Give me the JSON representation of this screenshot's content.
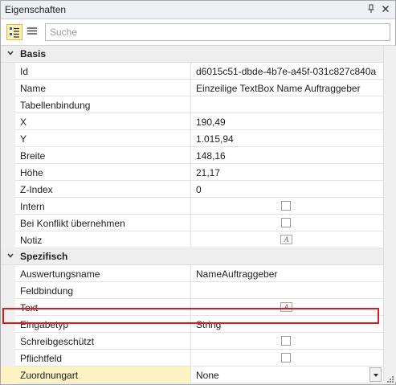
{
  "window": {
    "title": "Eigenschaften",
    "pin_glyph": "⮾",
    "close_glyph": "✕"
  },
  "toolbar": {
    "categorized_icon": "categorized-view-icon",
    "alphabetical_icon": "list-view-icon",
    "search_placeholder": "Suche"
  },
  "categories": {
    "basis": {
      "label": "Basis",
      "rows": [
        {
          "name": "Id",
          "value": "d6015c51-dbde-4b7e-a45f-031c827c840a",
          "editor": "text"
        },
        {
          "name": "Name",
          "value": "Einzeilige TextBox Name Auftraggeber",
          "editor": "text"
        },
        {
          "name": "Tabellenbindung",
          "value": "",
          "editor": "text"
        },
        {
          "name": "X",
          "value": "190,49",
          "editor": "text"
        },
        {
          "name": "Y",
          "value": "1.015,94",
          "editor": "text"
        },
        {
          "name": "Breite",
          "value": "148,16",
          "editor": "text"
        },
        {
          "name": "Höhe",
          "value": "21,17",
          "editor": "text"
        },
        {
          "name": "Z-Index",
          "value": "0",
          "editor": "text"
        },
        {
          "name": "Intern",
          "value": "",
          "editor": "checkbox",
          "checked": false
        },
        {
          "name": "Bei Konflikt übernehmen",
          "value": "",
          "editor": "checkbox",
          "checked": false
        },
        {
          "name": "Notiz",
          "value": "",
          "editor": "dialog"
        }
      ]
    },
    "spezifisch": {
      "label": "Spezifisch",
      "rows": [
        {
          "name": "Auswertungsname",
          "value": "NameAuftraggeber",
          "editor": "text",
          "highlighted": true
        },
        {
          "name": "Feldbindung",
          "value": "",
          "editor": "text"
        },
        {
          "name": "Text",
          "value": "",
          "editor": "dialog"
        },
        {
          "name": "Eingabetyp",
          "value": "String",
          "editor": "text"
        },
        {
          "name": "Schreibgeschützt",
          "value": "",
          "editor": "checkbox",
          "checked": false
        },
        {
          "name": "Pflichtfeld",
          "value": "",
          "editor": "checkbox",
          "checked": false
        },
        {
          "name": "Zuordnungart",
          "value": "None",
          "editor": "dropdown",
          "selected": true
        }
      ]
    }
  },
  "dialog_icon_glyph": "A",
  "colors": {
    "highlight": "#e0191d",
    "selected_row": "#fff3c4",
    "category_bg": "#eeeeee"
  }
}
